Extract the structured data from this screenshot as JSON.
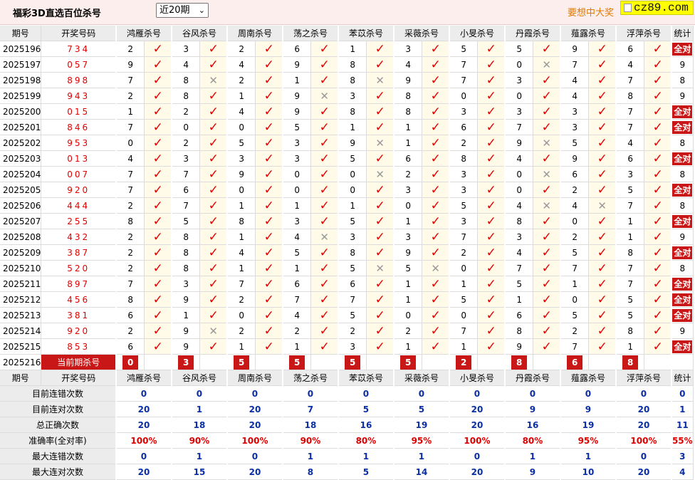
{
  "app": {
    "title": "福彩3D直选百位杀号",
    "slogan": "要想中大奖",
    "logo_text": "cz89.com"
  },
  "period_select": {
    "value": "近20期"
  },
  "header": {
    "period": "期号",
    "numbers": "开奖号码",
    "stat": "统计"
  },
  "experts": [
    "鸿雁杀号",
    "谷风杀号",
    "周南杀号",
    "荡之杀号",
    "苯苡杀号",
    "采薇杀号",
    "小旻杀号",
    "丹霞杀号",
    "薤露杀号",
    "浮萍杀号"
  ],
  "rows": [
    {
      "period": "2025196",
      "nums": "734",
      "kills": [
        [
          2,
          1
        ],
        [
          3,
          1
        ],
        [
          2,
          1
        ],
        [
          6,
          1
        ],
        [
          1,
          1
        ],
        [
          3,
          1
        ],
        [
          5,
          1
        ],
        [
          5,
          1
        ],
        [
          9,
          1
        ],
        [
          6,
          1
        ]
      ],
      "stat": "全对"
    },
    {
      "period": "2025197",
      "nums": "057",
      "kills": [
        [
          9,
          1
        ],
        [
          4,
          1
        ],
        [
          4,
          1
        ],
        [
          9,
          1
        ],
        [
          8,
          1
        ],
        [
          4,
          1
        ],
        [
          7,
          1
        ],
        [
          0,
          0
        ],
        [
          7,
          1
        ],
        [
          4,
          1
        ]
      ],
      "stat": "9"
    },
    {
      "period": "2025198",
      "nums": "898",
      "kills": [
        [
          7,
          1
        ],
        [
          8,
          0
        ],
        [
          2,
          1
        ],
        [
          1,
          1
        ],
        [
          8,
          0
        ],
        [
          9,
          1
        ],
        [
          7,
          1
        ],
        [
          3,
          1
        ],
        [
          4,
          1
        ],
        [
          7,
          1
        ]
      ],
      "stat": "8"
    },
    {
      "period": "2025199",
      "nums": "943",
      "kills": [
        [
          2,
          1
        ],
        [
          8,
          1
        ],
        [
          1,
          1
        ],
        [
          9,
          0
        ],
        [
          3,
          1
        ],
        [
          8,
          1
        ],
        [
          0,
          1
        ],
        [
          0,
          1
        ],
        [
          4,
          1
        ],
        [
          8,
          1
        ]
      ],
      "stat": "9"
    },
    {
      "period": "2025200",
      "nums": "015",
      "kills": [
        [
          1,
          1
        ],
        [
          2,
          1
        ],
        [
          4,
          1
        ],
        [
          9,
          1
        ],
        [
          8,
          1
        ],
        [
          8,
          1
        ],
        [
          3,
          1
        ],
        [
          3,
          1
        ],
        [
          3,
          1
        ],
        [
          7,
          1
        ]
      ],
      "stat": "全对"
    },
    {
      "period": "2025201",
      "nums": "846",
      "kills": [
        [
          7,
          1
        ],
        [
          0,
          1
        ],
        [
          0,
          1
        ],
        [
          5,
          1
        ],
        [
          1,
          1
        ],
        [
          1,
          1
        ],
        [
          6,
          1
        ],
        [
          7,
          1
        ],
        [
          3,
          1
        ],
        [
          7,
          1
        ]
      ],
      "stat": "全对"
    },
    {
      "period": "2025202",
      "nums": "953",
      "kills": [
        [
          0,
          1
        ],
        [
          2,
          1
        ],
        [
          5,
          1
        ],
        [
          3,
          1
        ],
        [
          9,
          0
        ],
        [
          1,
          1
        ],
        [
          2,
          1
        ],
        [
          9,
          0
        ],
        [
          5,
          1
        ],
        [
          4,
          1
        ]
      ],
      "stat": "8"
    },
    {
      "period": "2025203",
      "nums": "013",
      "kills": [
        [
          4,
          1
        ],
        [
          3,
          1
        ],
        [
          3,
          1
        ],
        [
          3,
          1
        ],
        [
          5,
          1
        ],
        [
          6,
          1
        ],
        [
          8,
          1
        ],
        [
          4,
          1
        ],
        [
          9,
          1
        ],
        [
          6,
          1
        ]
      ],
      "stat": "全对"
    },
    {
      "period": "2025204",
      "nums": "007",
      "kills": [
        [
          7,
          1
        ],
        [
          7,
          1
        ],
        [
          9,
          1
        ],
        [
          0,
          1
        ],
        [
          0,
          0
        ],
        [
          2,
          1
        ],
        [
          3,
          1
        ],
        [
          0,
          0
        ],
        [
          6,
          1
        ],
        [
          3,
          1
        ]
      ],
      "stat": "8"
    },
    {
      "period": "2025205",
      "nums": "920",
      "kills": [
        [
          7,
          1
        ],
        [
          6,
          1
        ],
        [
          0,
          1
        ],
        [
          0,
          1
        ],
        [
          0,
          1
        ],
        [
          3,
          1
        ],
        [
          3,
          1
        ],
        [
          0,
          1
        ],
        [
          2,
          1
        ],
        [
          5,
          1
        ]
      ],
      "stat": "全对"
    },
    {
      "period": "2025206",
      "nums": "444",
      "kills": [
        [
          2,
          1
        ],
        [
          7,
          1
        ],
        [
          1,
          1
        ],
        [
          1,
          1
        ],
        [
          1,
          1
        ],
        [
          0,
          1
        ],
        [
          5,
          1
        ],
        [
          4,
          0
        ],
        [
          4,
          0
        ],
        [
          7,
          1
        ]
      ],
      "stat": "8"
    },
    {
      "period": "2025207",
      "nums": "255",
      "kills": [
        [
          8,
          1
        ],
        [
          5,
          1
        ],
        [
          8,
          1
        ],
        [
          3,
          1
        ],
        [
          5,
          1
        ],
        [
          1,
          1
        ],
        [
          3,
          1
        ],
        [
          8,
          1
        ],
        [
          0,
          1
        ],
        [
          1,
          1
        ]
      ],
      "stat": "全对"
    },
    {
      "period": "2025208",
      "nums": "432",
      "kills": [
        [
          2,
          1
        ],
        [
          8,
          1
        ],
        [
          1,
          1
        ],
        [
          4,
          0
        ],
        [
          3,
          1
        ],
        [
          3,
          1
        ],
        [
          7,
          1
        ],
        [
          3,
          1
        ],
        [
          2,
          1
        ],
        [
          1,
          1
        ]
      ],
      "stat": "9"
    },
    {
      "period": "2025209",
      "nums": "387",
      "kills": [
        [
          2,
          1
        ],
        [
          8,
          1
        ],
        [
          4,
          1
        ],
        [
          5,
          1
        ],
        [
          8,
          1
        ],
        [
          9,
          1
        ],
        [
          2,
          1
        ],
        [
          4,
          1
        ],
        [
          5,
          1
        ],
        [
          8,
          1
        ]
      ],
      "stat": "全对"
    },
    {
      "period": "2025210",
      "nums": "520",
      "kills": [
        [
          2,
          1
        ],
        [
          8,
          1
        ],
        [
          1,
          1
        ],
        [
          1,
          1
        ],
        [
          5,
          0
        ],
        [
          5,
          0
        ],
        [
          0,
          1
        ],
        [
          7,
          1
        ],
        [
          7,
          1
        ],
        [
          7,
          1
        ]
      ],
      "stat": "8"
    },
    {
      "period": "2025211",
      "nums": "897",
      "kills": [
        [
          7,
          1
        ],
        [
          3,
          1
        ],
        [
          7,
          1
        ],
        [
          6,
          1
        ],
        [
          6,
          1
        ],
        [
          1,
          1
        ],
        [
          1,
          1
        ],
        [
          5,
          1
        ],
        [
          1,
          1
        ],
        [
          7,
          1
        ]
      ],
      "stat": "全对"
    },
    {
      "period": "2025212",
      "nums": "456",
      "kills": [
        [
          8,
          1
        ],
        [
          9,
          1
        ],
        [
          2,
          1
        ],
        [
          7,
          1
        ],
        [
          7,
          1
        ],
        [
          1,
          1
        ],
        [
          5,
          1
        ],
        [
          1,
          1
        ],
        [
          0,
          1
        ],
        [
          5,
          1
        ]
      ],
      "stat": "全对"
    },
    {
      "period": "2025213",
      "nums": "381",
      "kills": [
        [
          6,
          1
        ],
        [
          1,
          1
        ],
        [
          0,
          1
        ],
        [
          4,
          1
        ],
        [
          5,
          1
        ],
        [
          0,
          1
        ],
        [
          0,
          1
        ],
        [
          6,
          1
        ],
        [
          5,
          1
        ],
        [
          5,
          1
        ]
      ],
      "stat": "全对"
    },
    {
      "period": "2025214",
      "nums": "920",
      "kills": [
        [
          2,
          1
        ],
        [
          9,
          0
        ],
        [
          2,
          1
        ],
        [
          2,
          1
        ],
        [
          2,
          1
        ],
        [
          2,
          1
        ],
        [
          7,
          1
        ],
        [
          8,
          1
        ],
        [
          2,
          1
        ],
        [
          8,
          1
        ]
      ],
      "stat": "9"
    },
    {
      "period": "2025215",
      "nums": "853",
      "kills": [
        [
          6,
          1
        ],
        [
          9,
          1
        ],
        [
          1,
          1
        ],
        [
          1,
          1
        ],
        [
          3,
          1
        ],
        [
          1,
          1
        ],
        [
          1,
          1
        ],
        [
          9,
          1
        ],
        [
          7,
          1
        ],
        [
          1,
          1
        ]
      ],
      "stat": "全对"
    }
  ],
  "current": {
    "period": "2025216",
    "label": "当前期杀号",
    "values": [
      "0",
      "3",
      "5",
      "5",
      "5",
      "5",
      "2",
      "8",
      "6",
      "8"
    ]
  },
  "stats": [
    {
      "label": "目前连错次数",
      "values": [
        "0",
        "0",
        "0",
        "0",
        "0",
        "0",
        "0",
        "0",
        "0",
        "0",
        "0"
      ],
      "color": "blue"
    },
    {
      "label": "目前连对次数",
      "values": [
        "20",
        "1",
        "20",
        "7",
        "5",
        "5",
        "20",
        "9",
        "9",
        "20",
        "1"
      ],
      "color": "blue"
    },
    {
      "label": "总正确次数",
      "values": [
        "20",
        "18",
        "20",
        "18",
        "16",
        "19",
        "20",
        "16",
        "19",
        "20",
        "11"
      ],
      "color": "blue"
    },
    {
      "label": "准确率(全对率)",
      "values": [
        "100%",
        "90%",
        "100%",
        "90%",
        "80%",
        "95%",
        "100%",
        "80%",
        "95%",
        "100%",
        "55%"
      ],
      "color": "red"
    },
    {
      "label": "最大连错次数",
      "values": [
        "0",
        "1",
        "0",
        "1",
        "1",
        "1",
        "0",
        "1",
        "1",
        "0",
        "3"
      ],
      "color": "blue"
    },
    {
      "label": "最大连对次数",
      "values": [
        "20",
        "15",
        "20",
        "8",
        "5",
        "14",
        "20",
        "9",
        "10",
        "20",
        "4"
      ],
      "color": "blue"
    }
  ],
  "colors": {
    "accent": "#c91717",
    "header_bg": "#ececec",
    "check": "#e00000",
    "cross": "#999999",
    "blue_text": "#0a2ea6"
  }
}
